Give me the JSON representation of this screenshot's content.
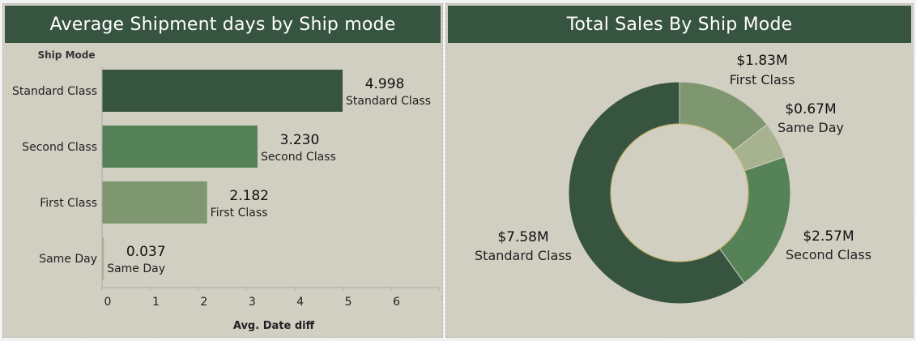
{
  "dashboard": {
    "left_title": "Average Shipment days by Ship mode",
    "right_title": "Total Sales By Ship Mode"
  },
  "chart_data": [
    {
      "type": "bar",
      "orientation": "horizontal",
      "title": "Average Shipment days by Ship mode",
      "ylabel": "Ship Mode",
      "xlabel": "Avg. Date diff",
      "categories": [
        "Standard Class",
        "Second Class",
        "First Class",
        "Same Day"
      ],
      "values": [
        4.998,
        3.23,
        2.182,
        0.037
      ],
      "value_labels": [
        "4.998",
        "3.230",
        "2.182",
        "0.037"
      ],
      "xlim": [
        0,
        7
      ],
      "xticks": [
        "0",
        "1",
        "2",
        "3",
        "4",
        "5",
        "6",
        "7"
      ],
      "colors": [
        "#375441",
        "#558257",
        "#7e9770",
        "#a7b38e"
      ],
      "grid": false
    },
    {
      "type": "pie",
      "style": "donut",
      "title": "Total Sales By Ship Mode",
      "categories": [
        "First Class",
        "Same Day",
        "Second Class",
        "Standard Class"
      ],
      "values": [
        1.83,
        0.67,
        2.57,
        7.58
      ],
      "value_labels": [
        "$1.83M",
        "$0.67M",
        "$2.57M",
        "$7.58M"
      ],
      "colors": [
        "#7e9770",
        "#a7b38e",
        "#558257",
        "#375441"
      ],
      "hole_color": "#d1cec2",
      "hole_border_color": "#c8b25a"
    }
  ]
}
